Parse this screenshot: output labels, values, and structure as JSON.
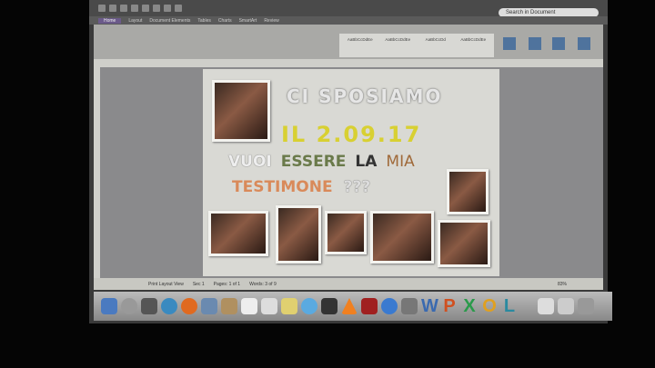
{
  "search": {
    "placeholder": "Search in Document"
  },
  "tabs": [
    "Home",
    "Layout",
    "Document Elements",
    "Tables",
    "Charts",
    "SmartArt",
    "Review"
  ],
  "styles": [
    "AaBbCcDdEe",
    "AaBbCcDdEe",
    "AaBbCcDd",
    "AaBbCcDdEe"
  ],
  "document": {
    "line1": "CI SPOSIAMO",
    "line2": "IL 2.09.17",
    "line3a": "VUOI",
    "line3b": "ESSERE",
    "line3c": "LA",
    "line3d": "MIA",
    "line4a": "TESTIMONE",
    "line4b": "???"
  },
  "status": {
    "view": "Print Layout View",
    "sec": "Sec 1",
    "pages": "Pages: 1 of 1",
    "words": "Words: 3 of 9",
    "zoom": "83%"
  },
  "dock": {
    "letters": [
      "W",
      "P",
      "X",
      "O",
      "L"
    ]
  },
  "colors": {
    "line1": "#e6e6e6",
    "line2": "#d8d032",
    "essere": "#6a7a4a",
    "testimone": "#d98a5a"
  }
}
